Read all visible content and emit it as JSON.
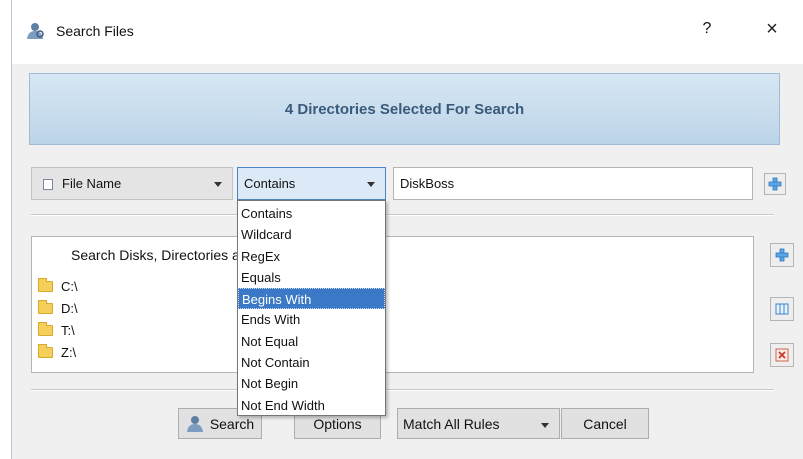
{
  "window": {
    "title": "Search Files",
    "help_label": "?",
    "close_label": "×"
  },
  "banner": {
    "text": "4 Directories Selected For Search"
  },
  "rule": {
    "field_label": "File Name",
    "operator_label": "Contains",
    "value": "DiskBoss"
  },
  "directories": {
    "header": "Search Disks, Directories and Network Shares",
    "items": [
      "C:\\",
      "D:\\",
      "T:\\",
      "Z:\\"
    ]
  },
  "operator_menu": {
    "options": [
      "Contains",
      "Wildcard",
      "RegEx",
      "Equals",
      "Begins With",
      "Ends With",
      "Not Equal",
      "Not Contain",
      "Not Begin",
      "Not End Width"
    ],
    "highlighted": "Begins With"
  },
  "buttons": {
    "search": "Search",
    "options": "Options",
    "match": "Match All Rules",
    "cancel": "Cancel"
  },
  "icons": {
    "title": "user-search-icon",
    "add_rule": "plus-icon",
    "add_dir": "plus-icon",
    "columns": "columns-icon",
    "remove": "remove-icon",
    "folder": "folder-icon"
  },
  "colors": {
    "banner_text": "#3a5a7a",
    "selection": "#3b78c5",
    "folder": "#f4cf5a"
  }
}
